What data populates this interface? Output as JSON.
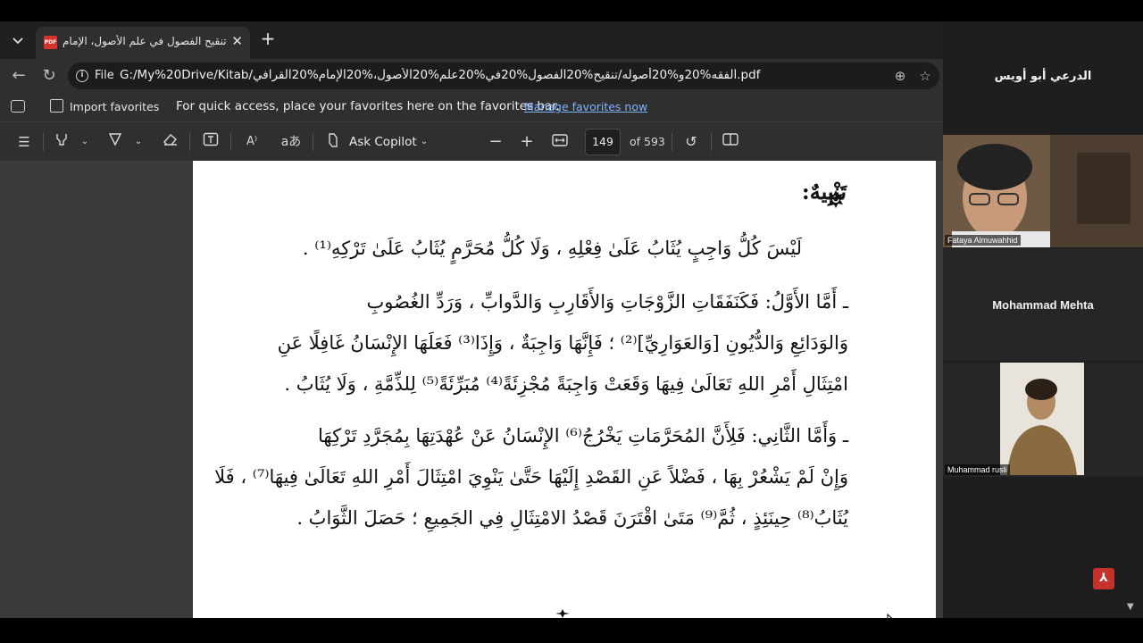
{
  "browser": {
    "tab": {
      "title": "تنقيح الفصول في علم الأصول، الإمام",
      "favicon_text": "PDF"
    },
    "address": {
      "scheme_label": "File",
      "url": "G:/My%20Drive/Kitab/الفقه%20و%20أصوله/تنقيح%20الفصول%20في%20علم%20الأصول،%20الإمام%20القرافي.pdf"
    },
    "favorites": {
      "import_label": "Import favorites",
      "message": "For quick access, place your favorites here on the favorites bar.",
      "manage_link": "Manage favorites now"
    },
    "pdf_toolbar": {
      "copilot_label": "Ask Copilot",
      "current_page": "149",
      "page_total": "of 593"
    }
  },
  "document": {
    "heading": "تَنْبِيهٌ:",
    "lines": [
      "لَيْسَ كُلُّ وَاجِبٍ يُثَابُ عَلَىٰ فِعْلِهِ ، وَلَا كُلُّ مُحَرَّمٍ يُثَابُ عَلَىٰ تَرْكِهِ⁽¹⁾ .",
      "ـ أَمَّا الأَوَّلُ: فَكَنَفَقَاتِ الزَّوْجَاتِ وَالأَقَارِبِ وَالدَّوابِّ ، وَرَدِّ الغُصُوبِ",
      "وَالوَدَائِعِ وَالدُّيُونِ [وَالعَوَارِيِّ]⁽²⁾ ؛ فَإِنَّهَا وَاجِبَةٌ ، وَإِذَا⁽³⁾ فَعَلَهَا الإِنْسَانُ غَافِلًا عَنِ",
      "امْتِثَالِ أَمْرِ اللهِ تَعَالَىٰ فِيهَا وَقَعَتْ وَاجِبَةً مُجْزِئَةً⁽⁴⁾ مُبَرِّئَةً⁽⁵⁾ لِلذِّمَّةِ ، وَلَا يُثَابُ .",
      "ـ وَأَمَّا الثَّانِي: فَلِأَنَّ المُحَرَّمَاتِ يَخْرُجُ⁽⁶⁾ الإِنْسَانُ عَنْ عُهْدَتِهَا بِمُجَرَّدِ تَرْكِهَا",
      "وَإِنْ لَمْ يَشْعُرْ بِهَا ، فَضْلاً عَنِ القَصْدِ إِلَيْهَا حَتَّىٰ يَنْوِيَ امْتِثَالَ أَمْرِ اللهِ تَعَالَىٰ فِيهَا⁽⁷⁾ ، فَلَا",
      "يُثَابُ⁽⁸⁾ حِينَئِذٍ ، ثُمَّ⁽⁹⁾ مَتَىٰ اقْتَرَنَ قَصْدُ الامْتِثَالِ فِي الجَمِيعِ ؛ حَصَلَ الثَّوَابُ ."
    ]
  },
  "participants": [
    {
      "name": "الدرعي أبو أويس",
      "video": false
    },
    {
      "name": "Fataya Almuwahhid",
      "video": true
    },
    {
      "name": "Mohammad Mehta",
      "video": false
    },
    {
      "name": "Muhammad rusli",
      "video": true
    }
  ]
}
